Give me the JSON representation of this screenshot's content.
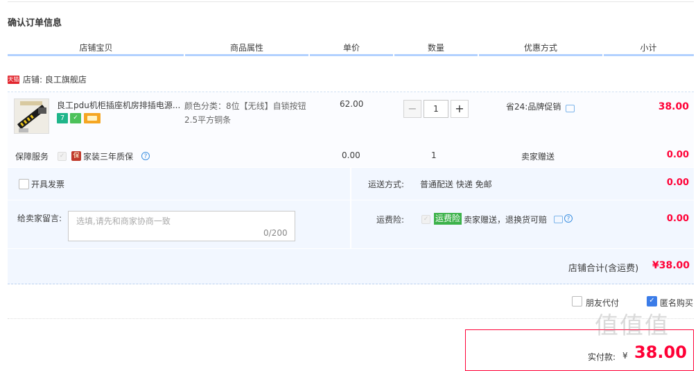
{
  "page_title": "确认订单信息",
  "columns": [
    "店铺宝贝",
    "商品属性",
    "单价",
    "数量",
    "优惠方式",
    "小计"
  ],
  "shop": {
    "icon_text": "天猫",
    "name": "店铺: 良工旗舰店"
  },
  "item": {
    "title": "良工pdu机柜插座机房排插电源...",
    "attr_line1": "颜色分类：8位【无线】自锁按钮",
    "attr_line2": "2.5平方铜条",
    "badge_7": "7",
    "unit_price": "62.00",
    "quantity": "1",
    "qty_minus": "−",
    "qty_plus": "+",
    "promo": "省24:品牌促销",
    "subtotal": "38.00"
  },
  "service": {
    "label": "保障服务",
    "bao": "保",
    "name": "家装三年质保",
    "help": "?",
    "price": "0.00",
    "qty": "1",
    "promo": "卖家赠送",
    "subtotal": "0.00"
  },
  "invoice": {
    "label": "开具发票"
  },
  "shipping": {
    "label": "运送方式:",
    "value": "普通配送 快递 免邮",
    "amount": "0.00"
  },
  "message": {
    "label": "给卖家留言:",
    "placeholder": "选填,请先和商家协商一致",
    "count": "0/200"
  },
  "insurance": {
    "label": "运费险:",
    "badge": "运费险",
    "desc": "卖家赠送，退换货可赔",
    "amount": "0.00"
  },
  "shop_total": {
    "label": "店铺合计(含运费)",
    "value": "¥38.00"
  },
  "options": {
    "friend_pay": "朋友代付",
    "anonymous": "匿名购买"
  },
  "payment": {
    "label": "实付款:",
    "currency": "¥",
    "value": "38.00"
  },
  "watermark": "值值值",
  "colors": {
    "accent": "#ff0036",
    "header_bar": "#b2d1ff",
    "panel_bg": "#f2f7ff"
  }
}
